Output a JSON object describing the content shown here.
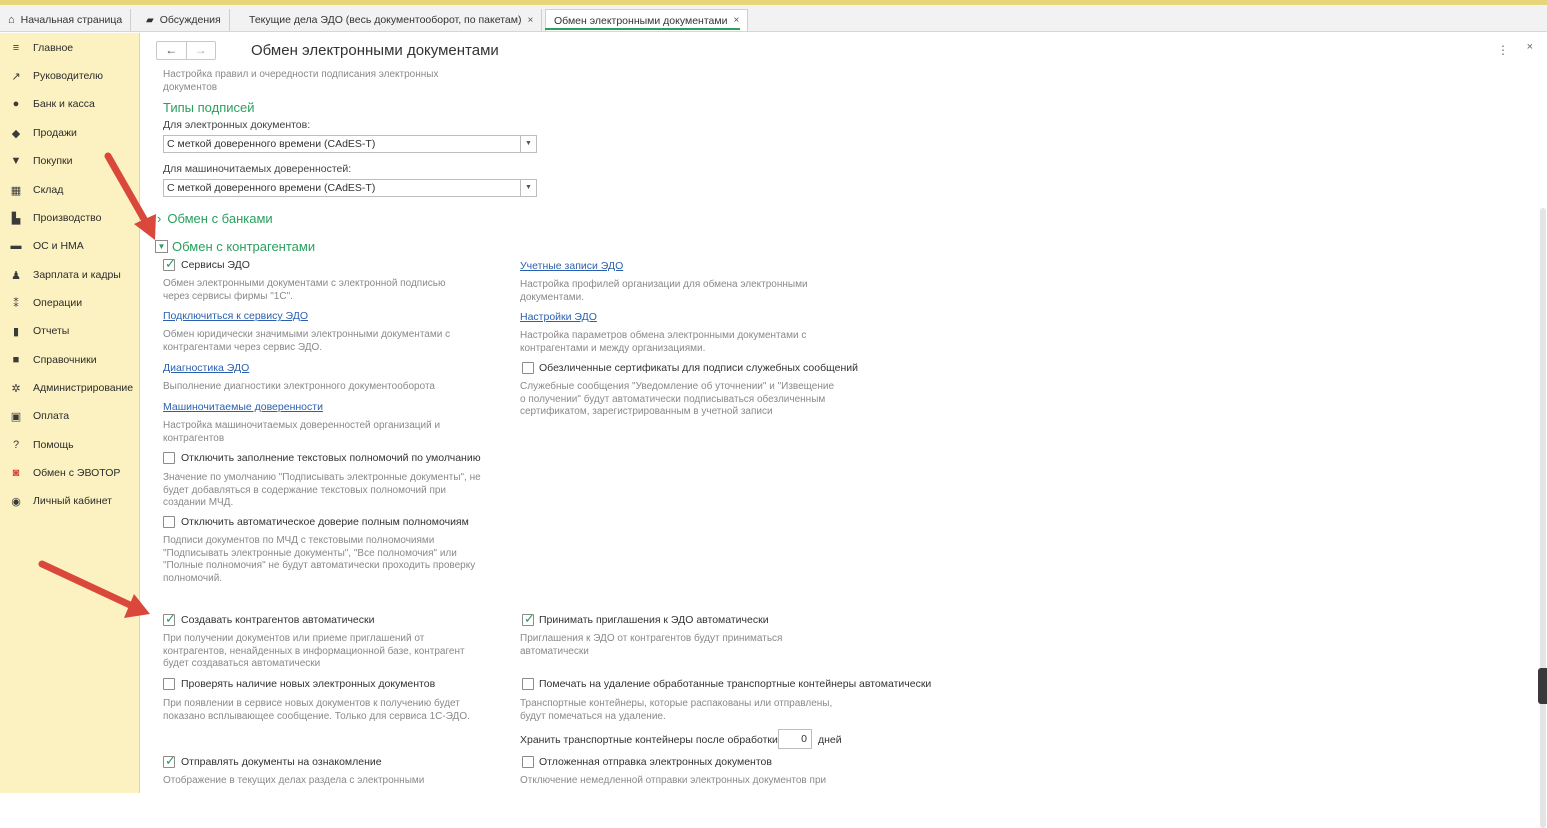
{
  "tabs": [
    {
      "label": "Начальная страница"
    },
    {
      "label": "Обсуждения"
    },
    {
      "label": "Текущие дела ЭДО (весь документооборот, по пакетам)",
      "close": "×"
    },
    {
      "label": "Обмен электронными документами",
      "close": "×"
    }
  ],
  "sidebar": {
    "items": [
      {
        "label": "Главное",
        "icon": "menu-icon"
      },
      {
        "label": "Руководителю",
        "icon": "trend-icon"
      },
      {
        "label": "Банк и касса",
        "icon": "coin-icon"
      },
      {
        "label": "Продажи",
        "icon": "bag-icon"
      },
      {
        "label": "Покупки",
        "icon": "cart-icon"
      },
      {
        "label": "Склад",
        "icon": "warehouse-icon"
      },
      {
        "label": "Производство",
        "icon": "factory-icon"
      },
      {
        "label": "ОС и НМА",
        "icon": "truck-icon"
      },
      {
        "label": "Зарплата и кадры",
        "icon": "person-icon"
      },
      {
        "label": "Операции",
        "icon": "operations-icon"
      },
      {
        "label": "Отчеты",
        "icon": "bar-chart-icon"
      },
      {
        "label": "Справочники",
        "icon": "book-icon"
      },
      {
        "label": "Администрирование",
        "icon": "gear-icon"
      },
      {
        "label": "Оплата",
        "icon": "wallet-icon"
      },
      {
        "label": "Помощь",
        "icon": "question-icon"
      },
      {
        "label": "Обмен с ЭВОТОР",
        "icon": "evotor-icon"
      },
      {
        "label": "Личный кабинет",
        "icon": "user-circle-icon"
      }
    ]
  },
  "header": {
    "back": "←",
    "forward": "→",
    "title": "Обмен электронными документами",
    "more": "⋮",
    "close": "×"
  },
  "content": {
    "intro_hint": "Настройка правил и очередности подписания электронных документов",
    "signature_types": {
      "heading": "Типы подписей",
      "edoc_label": "Для электронных документов:",
      "edoc_value": "С меткой доверенного времени (CAdES-T)",
      "mpoa_label": "Для машиночитаемых доверенностей:",
      "mpoa_value": "С меткой доверенного времени (CAdES-T)"
    },
    "banks_section": {
      "title": "Обмен с банками",
      "expanded": false
    },
    "counterparties_section": {
      "title": "Обмен с контрагентами",
      "expanded": true
    },
    "left": {
      "edo_services": {
        "label": "Сервисы ЭДО",
        "checked": true,
        "hint": "Обмен электронными документами с электронной подписью через сервисы фирмы \"1С\"."
      },
      "connect_link": {
        "label": "Подключиться к сервису ЭДО",
        "hint": "Обмен юридически значимыми электронными документами с контрагентами через сервис ЭДО."
      },
      "diag_link": {
        "label": "Диагностика ЭДО",
        "hint": "Выполнение диагностики электронного документооборота"
      },
      "mpoa_link": {
        "label": "Машиночитаемые доверенности",
        "hint": "Настройка машиночитаемых доверенностей организаций и контрагентов"
      },
      "disable_text_powers": {
        "label": "Отключить заполнение текстовых полномочий по умолчанию",
        "checked": false,
        "hint": "Значение по умолчанию \"Подписывать электронные документы\", не будет добавляться в содержание текстовых полномочий при создании МЧД."
      },
      "disable_auto_trust": {
        "label": "Отключить автоматическое доверие полным полномочиям",
        "checked": false,
        "hint": "Подписи документов по МЧД с текстовыми полномочиями \"Подписывать электронные документы\", \"Все полномочия\" или \"Полные полномочия\" не будут автоматически проходить проверку полномочий."
      },
      "create_counterparties": {
        "label": "Создавать контрагентов автоматически",
        "checked": true,
        "hint": "При получении документов или приеме приглашений от контрагентов, ненайденных в информационной базе, контрагент будет создаваться автоматически"
      },
      "check_new_docs": {
        "label": "Проверять наличие новых электронных документов",
        "checked": false,
        "hint": "При появлении в сервисе новых документов к получению будет показано всплывающее сообщение. Только для сервиса 1С-ЭДО."
      },
      "send_for_review": {
        "label": "Отправлять документы на ознакомление",
        "checked": true,
        "hint": "Отображение в текущих делах  раздела с электронными"
      }
    },
    "right": {
      "accounts_link": {
        "label": "Учетные записи ЭДО",
        "hint": "Настройка профилей организации для обмена электронными документами."
      },
      "settings_link": {
        "label": "Настройки ЭДО",
        "hint": "Настройка параметров обмена электронными документами с контрагентами и между организациями."
      },
      "impersonal_certs": {
        "label": "Обезличенные сертификаты для подписи служебных сообщений",
        "checked": false,
        "hint": "Служебные сообщения \"Уведомление об уточнении\" и \"Извещение о получении\" будут автоматически подписываться обезличенным сертификатом, зарегистрированным в учетной записи"
      },
      "accept_invites": {
        "label": "Принимать приглашения к ЭДО автоматически",
        "checked": true,
        "hint": "Приглашения к ЭДО от контрагентов будут приниматься автоматически"
      },
      "mark_containers": {
        "label": "Помечать на удаление обработанные транспортные контейнеры автоматически",
        "checked": false,
        "hint": "Транспортные контейнеры, которые распакованы или отправлены, будут помечаться на удаление."
      },
      "keep_containers": {
        "label": "Хранить транспортные контейнеры после обработки:",
        "value": "0",
        "unit": "дней"
      },
      "delayed_sending": {
        "label": "Отложенная отправка электронных документов",
        "checked": false,
        "hint": "Отключение немедленной отправки электронных документов при"
      }
    }
  },
  "colors": {
    "sidebar_bg": "#fcf2c1",
    "accent_green": "#2aa05d",
    "link_blue": "#2a5fb0",
    "annotation_arrow": "#d9483b"
  }
}
